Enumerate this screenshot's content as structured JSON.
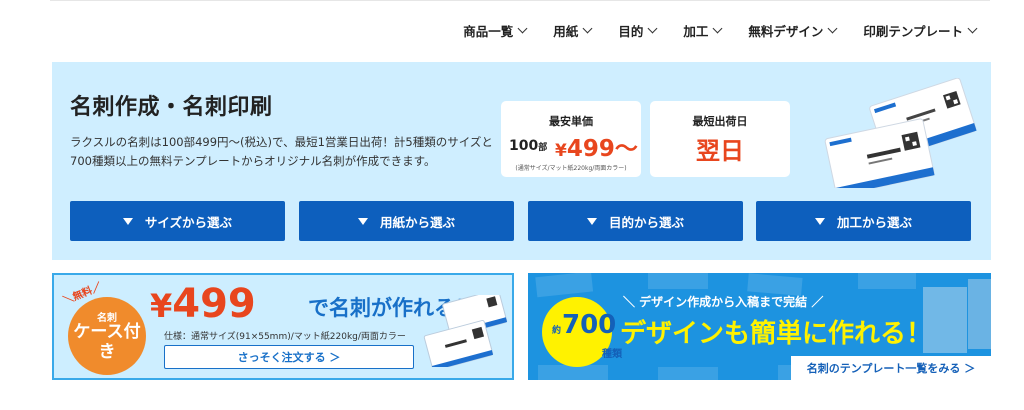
{
  "nav": {
    "items": [
      {
        "label": "商品一覧"
      },
      {
        "label": "用紙"
      },
      {
        "label": "目的"
      },
      {
        "label": "加工"
      },
      {
        "label": "無料デザイン"
      },
      {
        "label": "印刷テンプレート"
      }
    ]
  },
  "hero": {
    "title": "名刺作成・名刺印刷",
    "description": "ラクスルの名刺は100部499円～(税込)で、最短1営業日出荷！計5種類のサイズと700種類以上の無料テンプレートからオリジナル名刺が作成できます。",
    "price_card": {
      "label": "最安単価",
      "qty": "100",
      "qty_unit": "部",
      "price_yen": "¥",
      "price": "499～",
      "note": "(通常サイズ/マット紙220kg/両面カラー)"
    },
    "ship_card": {
      "label": "最短出荷日",
      "value": "翌日"
    },
    "category_buttons": [
      {
        "label": "サイズから選ぶ"
      },
      {
        "label": "用紙から選ぶ"
      },
      {
        "label": "目的から選ぶ"
      },
      {
        "label": "加工から選ぶ"
      }
    ]
  },
  "banner_case": {
    "free_label": "＼無料／",
    "badge_line1": "名刺",
    "badge_line2": "ケース付き",
    "price_yen": "¥",
    "price": "499",
    "headline": "で名刺が作れる！",
    "spec": "仕様：通常サイズ(91×55mm)/マット紙220kg/両面カラー",
    "cta": "さっそく注文する ＞"
  },
  "banner_design": {
    "top_text": "＼ デザイン作成から入稿まで完結 ／",
    "circle_prefix": "約",
    "circle_number": "700",
    "circle_unit": "種類",
    "headline": "デザインも簡単に作れる！",
    "cta": "名刺のテンプレート一覧をみる ＞"
  },
  "colors": {
    "accent_blue": "#0d5fbd",
    "price_orange": "#e8461e",
    "hero_bg": "#cfeeff"
  }
}
